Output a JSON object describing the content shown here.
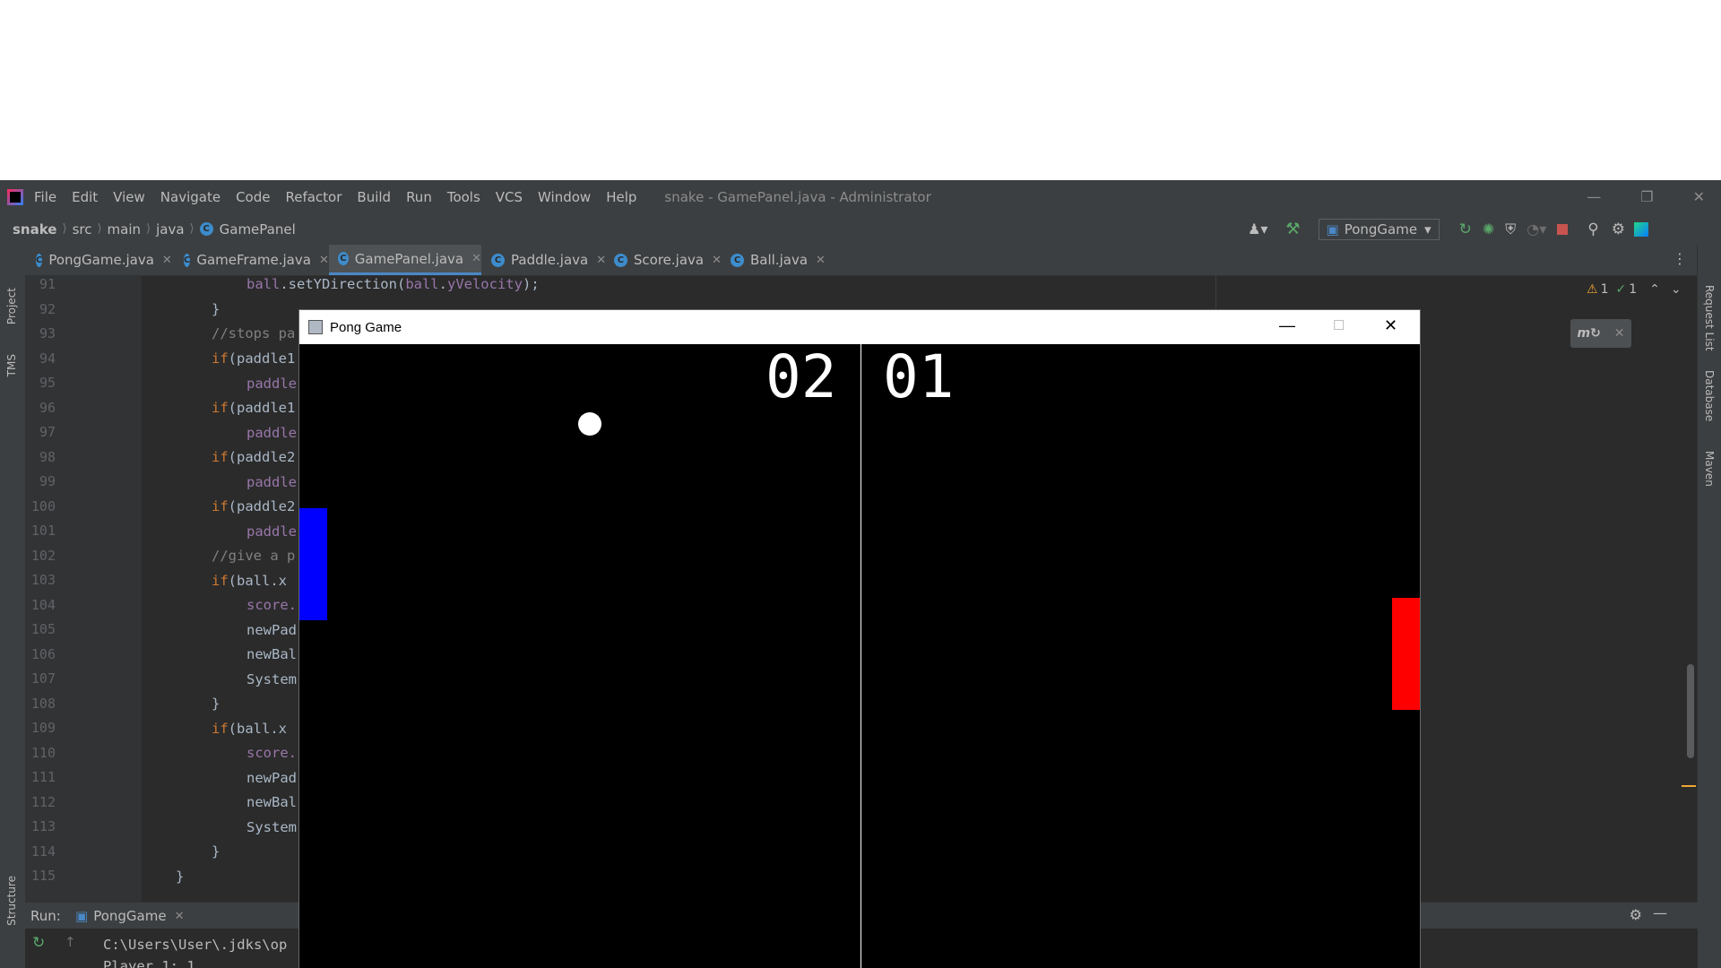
{
  "ide": {
    "menu": [
      "File",
      "Edit",
      "View",
      "Navigate",
      "Code",
      "Refactor",
      "Build",
      "Run",
      "Tools",
      "VCS",
      "Window",
      "Help"
    ],
    "window_title": "snake - GamePanel.java - Administrator",
    "breadcrumbs": [
      "snake",
      "src",
      "main",
      "java",
      "GamePanel"
    ],
    "run_config": "PongGame",
    "tabs": [
      {
        "label": "PongGame.java"
      },
      {
        "label": "GameFrame.java"
      },
      {
        "label": "GamePanel.java"
      },
      {
        "label": "Paddle.java"
      },
      {
        "label": "Score.java"
      },
      {
        "label": "Ball.java"
      }
    ],
    "inspections": {
      "warnings": "1",
      "weak_warnings": "1"
    },
    "left_tools": [
      "Project",
      "TMS",
      "Structure"
    ],
    "right_tools": [
      "Request List",
      "Database",
      "Maven"
    ],
    "run_label": "Run:",
    "run_tab": "PongGame",
    "console_lines": [
      "C:\\Users\\User\\.jdks\\op",
      "Player 1: 1"
    ],
    "line_numbers": [
      "91",
      "92",
      "93",
      "94",
      "95",
      "96",
      "97",
      "98",
      "99",
      "100",
      "101",
      "102",
      "103",
      "104",
      "105",
      "106",
      "107",
      "108",
      "109",
      "110",
      "111",
      "112",
      "113",
      "114",
      "115"
    ],
    "code_lines": {
      "l91_obj": "ball",
      "l91_call": ".setYDirection(",
      "l91_arg_obj": "ball",
      "l91_arg_dot": ".",
      "l91_arg_field": "yVelocity",
      "l91_end": ");",
      "l92": "}",
      "l93": "//stops pa",
      "l94_kw": "if",
      "l94_rest": "(paddle1",
      "l95": "paddle",
      "l96_kw": "if",
      "l96_rest": "(paddle1",
      "l97": "paddle",
      "l98_kw": "if",
      "l98_rest": "(paddle2",
      "l99": "paddle",
      "l100_kw": "if",
      "l100_rest": "(paddle2",
      "l101": "paddle",
      "l102": "//give a p",
      "l103_kw": "if",
      "l103_rest": "(ball.x",
      "l104": "score.",
      "l105": "newPad",
      "l106": "newBal",
      "l107": "System",
      "l108": "}",
      "l109_kw": "if",
      "l109_rest": "(ball.x",
      "l110": "score.",
      "l111": "newPad",
      "l112": "newBal",
      "l113": "System",
      "l114": "}",
      "l115": "}"
    }
  },
  "pong": {
    "title": "Pong Game",
    "score_left": "02",
    "score_right": "01",
    "colors": {
      "left_paddle": "#0000ff",
      "right_paddle": "#ff0000",
      "ball": "#ffffff",
      "background": "#000000"
    }
  }
}
